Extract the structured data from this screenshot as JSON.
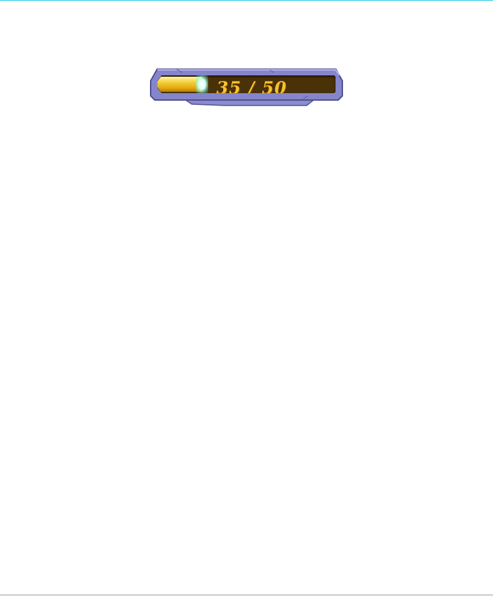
{
  "progress_bar": {
    "current": "35",
    "separator": "/",
    "max": "50",
    "fill_fraction": 0.25,
    "colors": {
      "frame": "#7f7fc6",
      "track": "#4a3208",
      "fill": "#f6d23c",
      "text": "#f6c32a",
      "glow": "#d8fff4"
    }
  }
}
